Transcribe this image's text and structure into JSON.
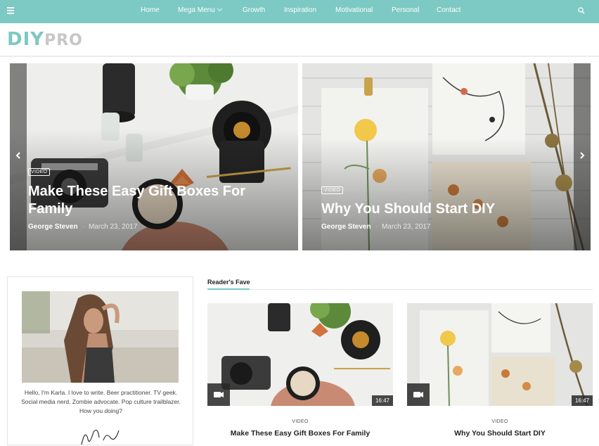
{
  "nav": {
    "items": [
      {
        "label": "Home"
      },
      {
        "label": "Mega Menu",
        "has_dropdown": true
      },
      {
        "label": "Growth"
      },
      {
        "label": "Inspiration"
      },
      {
        "label": "Motivational"
      },
      {
        "label": "Personal"
      },
      {
        "label": "Contact"
      }
    ],
    "menu_icon": "hamburger-icon",
    "search_icon": "search-icon"
  },
  "logo": {
    "part1": "DIY",
    "part2": "PRO"
  },
  "slider": {
    "slides": [
      {
        "badge": "VIDEO",
        "title": "Make These Easy Gift Boxes For Family",
        "author": "George Steven",
        "date": "March 23, 2017"
      },
      {
        "badge": "VIDEO",
        "title": "Why You Should Start DIY",
        "author": "George Steven",
        "date": "March 23, 2017"
      }
    ],
    "prev_icon": "chevron-left-icon",
    "next_icon": "chevron-right-icon"
  },
  "about": {
    "text": "Hello, I'm Karla. I love to write. Beer practitioner. TV geek. Social media nerd. Zombie advocate. Pop culture trailblazer. How you doing?"
  },
  "readers_fave": {
    "heading": "Reader's Fave",
    "cards": [
      {
        "category": "VIDEO",
        "title": "Make These Easy Gift Boxes For Family",
        "duration": "16:47"
      },
      {
        "category": "VIDEO",
        "title": "Why You Should Start DIY",
        "duration": "16:47"
      }
    ]
  },
  "colors": {
    "accent": "#7dc9c3",
    "text": "#222222"
  }
}
